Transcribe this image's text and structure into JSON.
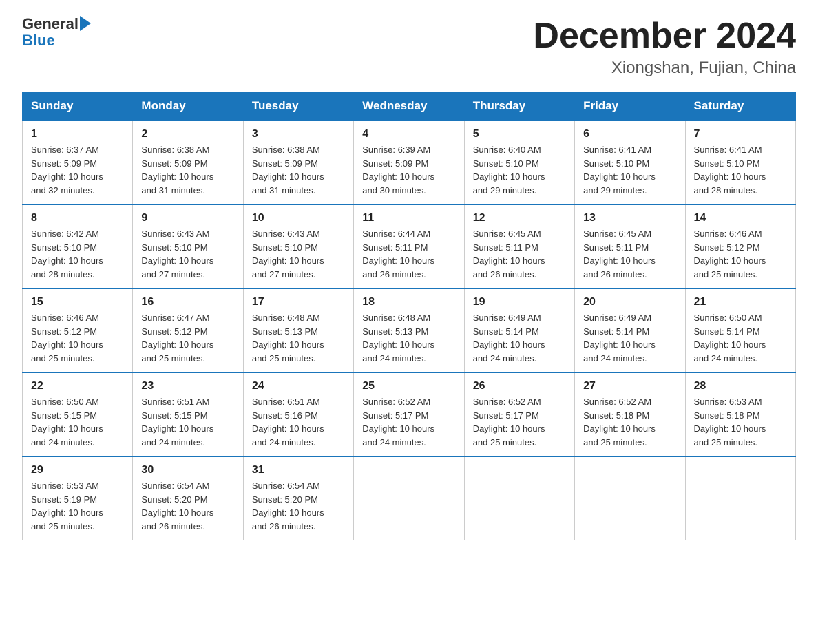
{
  "header": {
    "logo_general": "General",
    "logo_blue": "Blue",
    "month_title": "December 2024",
    "location": "Xiongshan, Fujian, China"
  },
  "days_of_week": [
    "Sunday",
    "Monday",
    "Tuesday",
    "Wednesday",
    "Thursday",
    "Friday",
    "Saturday"
  ],
  "weeks": [
    [
      {
        "day": "1",
        "sunrise": "6:37 AM",
        "sunset": "5:09 PM",
        "daylight": "10 hours and 32 minutes."
      },
      {
        "day": "2",
        "sunrise": "6:38 AM",
        "sunset": "5:09 PM",
        "daylight": "10 hours and 31 minutes."
      },
      {
        "day": "3",
        "sunrise": "6:38 AM",
        "sunset": "5:09 PM",
        "daylight": "10 hours and 31 minutes."
      },
      {
        "day": "4",
        "sunrise": "6:39 AM",
        "sunset": "5:09 PM",
        "daylight": "10 hours and 30 minutes."
      },
      {
        "day": "5",
        "sunrise": "6:40 AM",
        "sunset": "5:10 PM",
        "daylight": "10 hours and 29 minutes."
      },
      {
        "day": "6",
        "sunrise": "6:41 AM",
        "sunset": "5:10 PM",
        "daylight": "10 hours and 29 minutes."
      },
      {
        "day": "7",
        "sunrise": "6:41 AM",
        "sunset": "5:10 PM",
        "daylight": "10 hours and 28 minutes."
      }
    ],
    [
      {
        "day": "8",
        "sunrise": "6:42 AM",
        "sunset": "5:10 PM",
        "daylight": "10 hours and 28 minutes."
      },
      {
        "day": "9",
        "sunrise": "6:43 AM",
        "sunset": "5:10 PM",
        "daylight": "10 hours and 27 minutes."
      },
      {
        "day": "10",
        "sunrise": "6:43 AM",
        "sunset": "5:10 PM",
        "daylight": "10 hours and 27 minutes."
      },
      {
        "day": "11",
        "sunrise": "6:44 AM",
        "sunset": "5:11 PM",
        "daylight": "10 hours and 26 minutes."
      },
      {
        "day": "12",
        "sunrise": "6:45 AM",
        "sunset": "5:11 PM",
        "daylight": "10 hours and 26 minutes."
      },
      {
        "day": "13",
        "sunrise": "6:45 AM",
        "sunset": "5:11 PM",
        "daylight": "10 hours and 26 minutes."
      },
      {
        "day": "14",
        "sunrise": "6:46 AM",
        "sunset": "5:12 PM",
        "daylight": "10 hours and 25 minutes."
      }
    ],
    [
      {
        "day": "15",
        "sunrise": "6:46 AM",
        "sunset": "5:12 PM",
        "daylight": "10 hours and 25 minutes."
      },
      {
        "day": "16",
        "sunrise": "6:47 AM",
        "sunset": "5:12 PM",
        "daylight": "10 hours and 25 minutes."
      },
      {
        "day": "17",
        "sunrise": "6:48 AM",
        "sunset": "5:13 PM",
        "daylight": "10 hours and 25 minutes."
      },
      {
        "day": "18",
        "sunrise": "6:48 AM",
        "sunset": "5:13 PM",
        "daylight": "10 hours and 24 minutes."
      },
      {
        "day": "19",
        "sunrise": "6:49 AM",
        "sunset": "5:14 PM",
        "daylight": "10 hours and 24 minutes."
      },
      {
        "day": "20",
        "sunrise": "6:49 AM",
        "sunset": "5:14 PM",
        "daylight": "10 hours and 24 minutes."
      },
      {
        "day": "21",
        "sunrise": "6:50 AM",
        "sunset": "5:14 PM",
        "daylight": "10 hours and 24 minutes."
      }
    ],
    [
      {
        "day": "22",
        "sunrise": "6:50 AM",
        "sunset": "5:15 PM",
        "daylight": "10 hours and 24 minutes."
      },
      {
        "day": "23",
        "sunrise": "6:51 AM",
        "sunset": "5:15 PM",
        "daylight": "10 hours and 24 minutes."
      },
      {
        "day": "24",
        "sunrise": "6:51 AM",
        "sunset": "5:16 PM",
        "daylight": "10 hours and 24 minutes."
      },
      {
        "day": "25",
        "sunrise": "6:52 AM",
        "sunset": "5:17 PM",
        "daylight": "10 hours and 24 minutes."
      },
      {
        "day": "26",
        "sunrise": "6:52 AM",
        "sunset": "5:17 PM",
        "daylight": "10 hours and 25 minutes."
      },
      {
        "day": "27",
        "sunrise": "6:52 AM",
        "sunset": "5:18 PM",
        "daylight": "10 hours and 25 minutes."
      },
      {
        "day": "28",
        "sunrise": "6:53 AM",
        "sunset": "5:18 PM",
        "daylight": "10 hours and 25 minutes."
      }
    ],
    [
      {
        "day": "29",
        "sunrise": "6:53 AM",
        "sunset": "5:19 PM",
        "daylight": "10 hours and 25 minutes."
      },
      {
        "day": "30",
        "sunrise": "6:54 AM",
        "sunset": "5:20 PM",
        "daylight": "10 hours and 26 minutes."
      },
      {
        "day": "31",
        "sunrise": "6:54 AM",
        "sunset": "5:20 PM",
        "daylight": "10 hours and 26 minutes."
      },
      null,
      null,
      null,
      null
    ]
  ],
  "labels": {
    "sunrise": "Sunrise:",
    "sunset": "Sunset:",
    "daylight": "Daylight:"
  }
}
